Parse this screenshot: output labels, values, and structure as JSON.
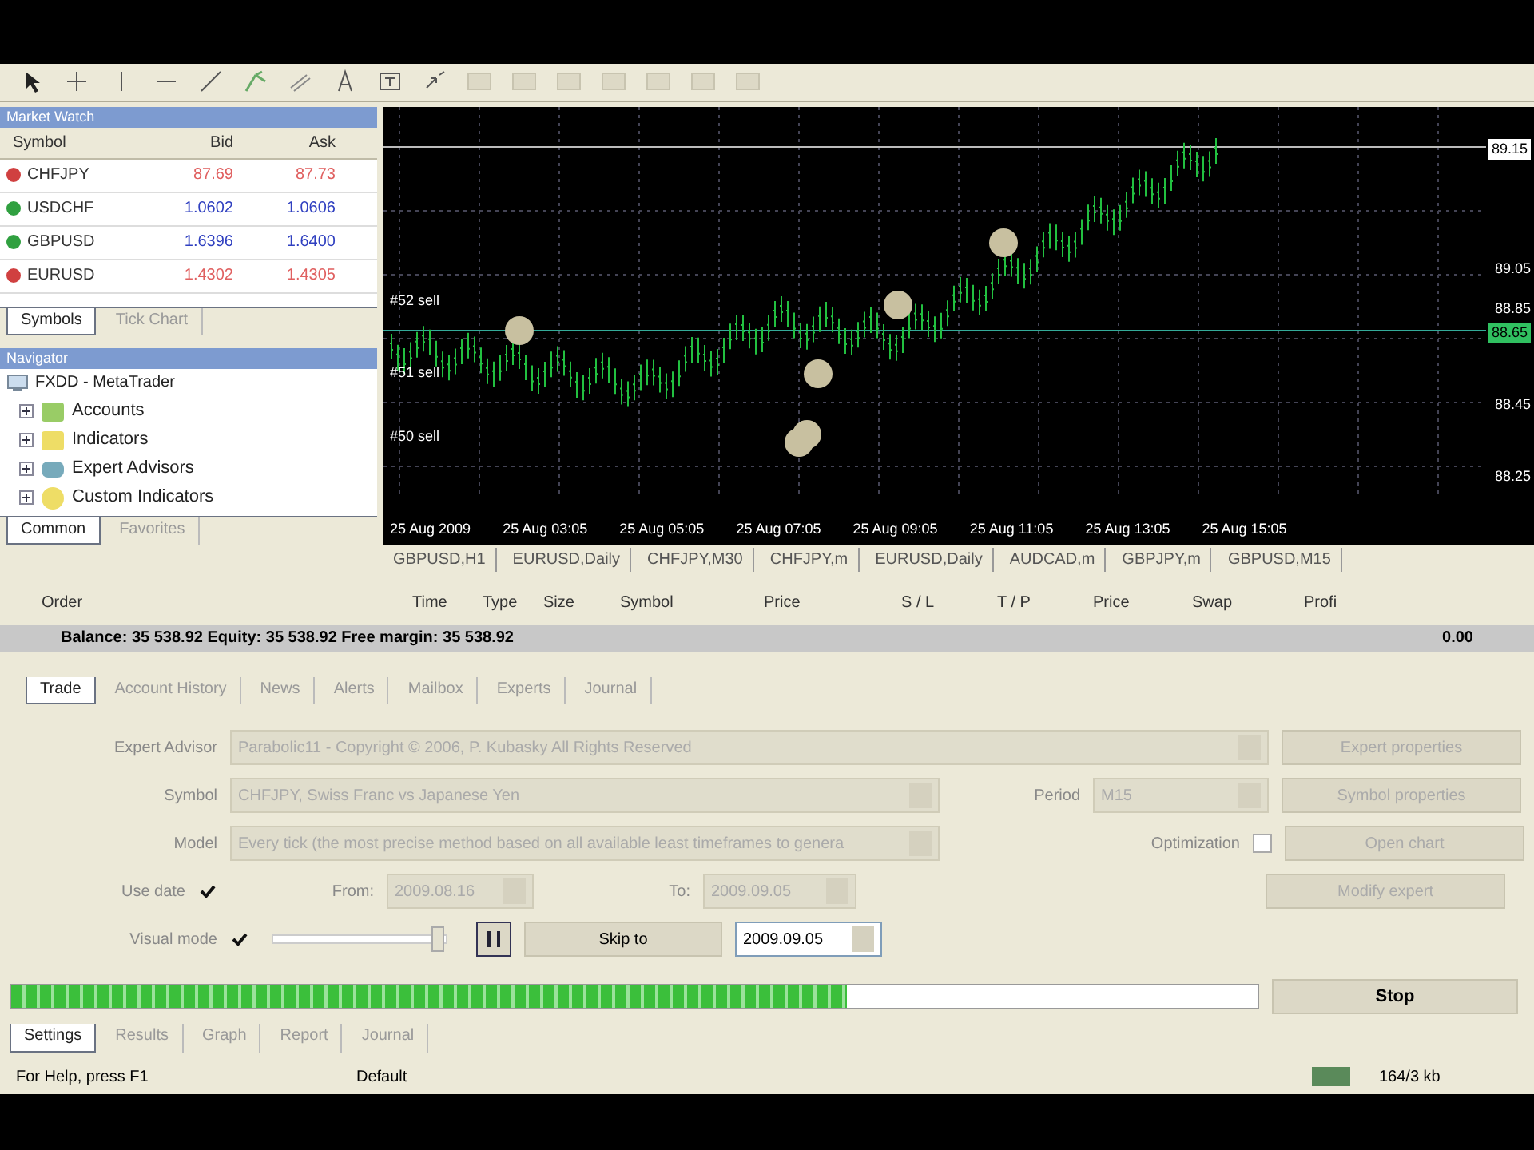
{
  "market_watch": {
    "title": "Market Watch",
    "columns": [
      "Symbol",
      "Bid",
      "Ask"
    ],
    "rows": [
      {
        "symbol": "CHFJPY",
        "bid": "87.69",
        "ask": "87.73",
        "color": "#d04040"
      },
      {
        "symbol": "USDCHF",
        "bid": "1.0602",
        "ask": "1.0606",
        "color": "#30a040"
      },
      {
        "symbol": "GBPUSD",
        "bid": "1.6396",
        "ask": "1.6400",
        "color": "#30a040"
      },
      {
        "symbol": "EURUSD",
        "bid": "1.4302",
        "ask": "1.4305",
        "color": "#d04040"
      }
    ],
    "tabs": [
      {
        "label": "Symbols",
        "selected": true
      },
      {
        "label": "Tick Chart",
        "selected": false
      }
    ]
  },
  "navigator": {
    "title": "Navigator",
    "root": "FXDD - MetaTrader",
    "items": [
      "Accounts",
      "Indicators",
      "Expert Advisors",
      "Custom Indicators"
    ],
    "tabs": [
      {
        "label": "Common",
        "selected": true
      },
      {
        "label": "Favorites",
        "selected": false
      }
    ]
  },
  "chart": {
    "trade_labels": [
      "#52 sell",
      "#51 sell",
      "#50 sell"
    ],
    "price_axis": [
      {
        "label": "89.15",
        "kind": "current"
      },
      {
        "label": "89.05",
        "kind": "tick"
      },
      {
        "label": "88.85",
        "kind": "tick"
      },
      {
        "label": "88.65",
        "kind": "bid"
      },
      {
        "label": "88.45",
        "kind": "tick"
      },
      {
        "label": "88.25",
        "kind": "tick"
      }
    ],
    "time_axis": [
      "25 Aug 2009",
      "25 Aug 03:05",
      "25 Aug 05:05",
      "25 Aug 07:05",
      "25 Aug 09:05",
      "25 Aug 11:05",
      "25 Aug 13:05",
      "25 Aug 15:05"
    ]
  },
  "chart_tabs": [
    {
      "label": "GBPUSD,H1",
      "selected": false
    },
    {
      "label": "EURUSD,Daily",
      "selected": false
    },
    {
      "label": "CHFJPY,M30",
      "selected": false
    },
    {
      "label": "CHFJPY,m",
      "selected": false
    },
    {
      "label": "EURUSD,Daily",
      "selected": false
    },
    {
      "label": "AUDCAD,m",
      "selected": false
    },
    {
      "label": "GBPJPY,m",
      "selected": false
    },
    {
      "label": "GBPUSD,M15",
      "selected": false
    }
  ],
  "terminal": {
    "columns": [
      "Order",
      "Time",
      "Type",
      "Size",
      "Symbol",
      "Price",
      "S / L",
      "T / P",
      "Price",
      "Swap",
      "Profi"
    ],
    "balance": "Balance: 35 538.92  Equity: 35 538.92  Free margin: 35 538.92",
    "profit": "0.00",
    "tabs": [
      {
        "label": "Trade",
        "selected": true
      },
      {
        "label": "Account History",
        "selected": false
      },
      {
        "label": "News",
        "selected": false
      },
      {
        "label": "Alerts",
        "selected": false
      },
      {
        "label": "Mailbox",
        "selected": false
      },
      {
        "label": "Experts",
        "selected": false
      },
      {
        "label": "Journal",
        "selected": false
      }
    ]
  },
  "tester": {
    "expert_label": "Expert Advisor",
    "expert": "Parabolic11 - Copyright © 2006, P. Kubasky All Rights Reserved",
    "symbol_label": "Symbol",
    "symbol": "CHFJPY, Swiss Franc vs Japanese Yen",
    "model_label": "Model",
    "model": "Every tick (the most precise method based on all available least timeframes to genera",
    "period_label": "Period",
    "period": "M15",
    "optimization_label": "Optimization",
    "optimization": false,
    "use_date_label": "Use date",
    "use_date": true,
    "from_label": "From:",
    "from": "2009.08.16",
    "to_label": "To:",
    "to": "2009.09.05",
    "visual_label": "Visual mode",
    "visual_mode": true,
    "speed": {
      "level": 0.95
    },
    "skip_button": "Skip to",
    "skip_date": "2009.09.05",
    "buttons": [
      "Expert properties",
      "Symbol properties",
      "Open chart",
      "Modify expert"
    ],
    "progress": {
      "level": 0.67
    },
    "stop_button": "Stop",
    "tabs": [
      {
        "label": "Settings",
        "selected": true
      },
      {
        "label": "Results",
        "selected": false
      },
      {
        "label": "Graph",
        "selected": false
      },
      {
        "label": "Report",
        "selected": false
      },
      {
        "label": "Journal",
        "selected": false
      }
    ]
  },
  "status_bar": {
    "help": "For Help, press F1",
    "profile": "Default",
    "traffic": "164/3 kb"
  }
}
